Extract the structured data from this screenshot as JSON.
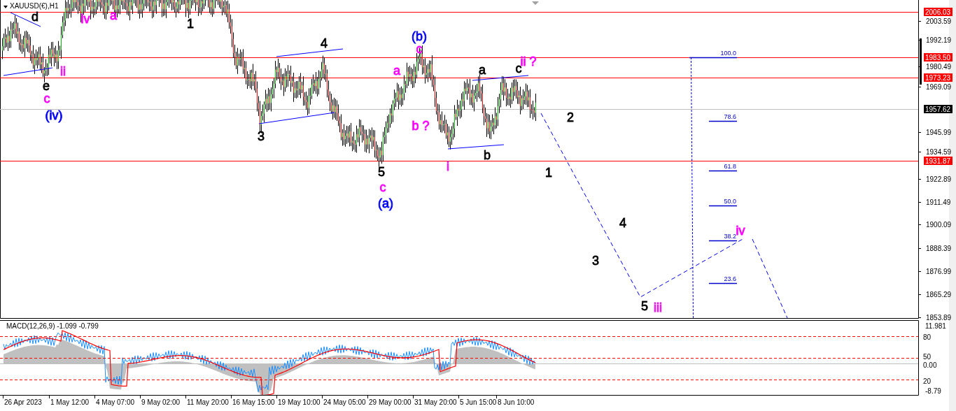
{
  "symbol_label": "XAUUSD(€),H1",
  "price_tags": [
    {
      "text": "2006.03",
      "kind": "level"
    },
    {
      "text": "1983.50",
      "kind": "level"
    },
    {
      "text": "1973.23",
      "kind": "level"
    },
    {
      "text": "1957.62",
      "kind": "current"
    },
    {
      "text": "1931.87",
      "kind": "level"
    }
  ],
  "price_axis": [
    "2003.59",
    "1992.19",
    "1980.49",
    "1969.09",
    "1945.99",
    "1934.59",
    "1922.89",
    "1911.49",
    "1900.09",
    "1888.39",
    "1876.99",
    "1865.29",
    "1853.89"
  ],
  "wave_labels": [
    {
      "text": "d",
      "color": "#000000"
    },
    {
      "text": "iv",
      "color": "#ff00ff"
    },
    {
      "text": "a",
      "color": "#ff00ff"
    },
    {
      "text": "1",
      "color": "#000000"
    },
    {
      "text": "4",
      "color": "#000000"
    },
    {
      "text": "(b)",
      "color": "#0000ff"
    },
    {
      "text": "c",
      "color": "#ff00ff"
    },
    {
      "text": "ii ?",
      "color": "#ff00ff"
    },
    {
      "text": "a",
      "color": "#ff00ff"
    },
    {
      "text": "a",
      "color": "#000000"
    },
    {
      "text": "c",
      "color": "#000000"
    },
    {
      "text": "e",
      "color": "#000000"
    },
    {
      "text": "ii",
      "color": "#ff00ff"
    },
    {
      "text": "c",
      "color": "#ff00ff"
    },
    {
      "text": "(iv)",
      "color": "#0000ff"
    },
    {
      "text": "2",
      "color": "#000000"
    },
    {
      "text": "3",
      "color": "#000000"
    },
    {
      "text": "b ?",
      "color": "#ff00ff"
    },
    {
      "text": "b",
      "color": "#000000"
    },
    {
      "text": "i",
      "color": "#ff00ff"
    },
    {
      "text": "5",
      "color": "#000000"
    },
    {
      "text": "1",
      "color": "#000000"
    },
    {
      "text": "c",
      "color": "#ff00ff"
    },
    {
      "text": "(a)",
      "color": "#0000ff"
    },
    {
      "text": "4",
      "color": "#000000"
    },
    {
      "text": "iv",
      "color": "#ff00ff"
    },
    {
      "text": "3",
      "color": "#000000"
    },
    {
      "text": "5",
      "color": "#000000"
    },
    {
      "text": "iii",
      "color": "#ff00ff"
    }
  ],
  "fib_levels": [
    "100.0",
    "78.6",
    "61.8",
    "50.0",
    "38.2",
    "23.6"
  ],
  "macd": {
    "label": "MACD(12,26,9) -1.099 -0.799",
    "axis": [
      "11.981",
      "80",
      "50",
      "0.00",
      "20",
      "-8.79"
    ]
  },
  "time_axis": [
    "26 Apr 2023",
    "1 May 12:00",
    "4 May 07:00",
    "9 May 02:00",
    "11 May 20:00",
    "16 May 15:00",
    "19 May 10:00",
    "24 May 05:00",
    "29 May 00:00",
    "31 May 20:00",
    "5 Jun 15:00",
    "8 Jun 10:00"
  ]
}
